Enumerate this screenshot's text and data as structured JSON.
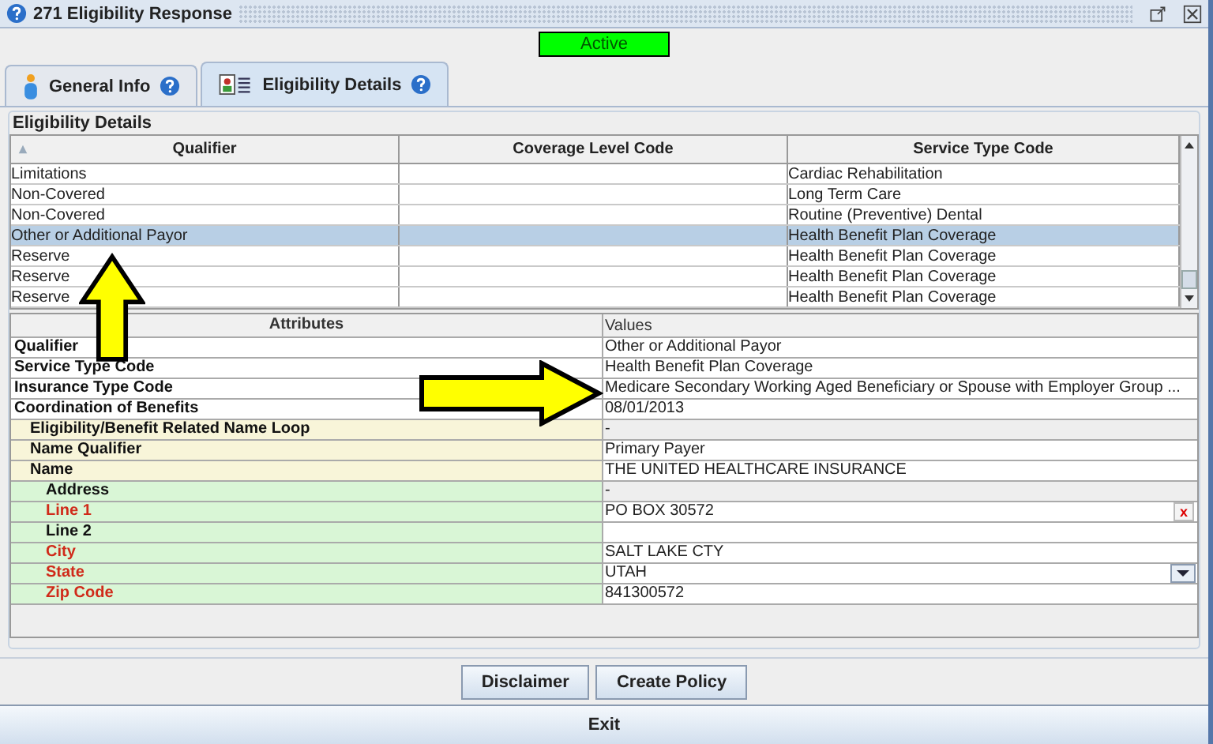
{
  "window": {
    "title": "271 Eligibility Response"
  },
  "status": {
    "label": "Active",
    "active": true
  },
  "tabs": [
    {
      "label": "General Info",
      "kind": "person",
      "selected": false
    },
    {
      "label": "Eligibility Details",
      "kind": "card",
      "selected": true
    }
  ],
  "group_title": "Eligibility Details",
  "table": {
    "columns": [
      "Qualifier",
      "Coverage Level Code",
      "Service Type Code"
    ],
    "rows": [
      {
        "cells": [
          "Limitations",
          "",
          "Cardiac Rehabilitation"
        ],
        "selected": false
      },
      {
        "cells": [
          "Non-Covered",
          "",
          "Long Term Care"
        ],
        "selected": false
      },
      {
        "cells": [
          "Non-Covered",
          "",
          "Routine (Preventive) Dental"
        ],
        "selected": false
      },
      {
        "cells": [
          "Other or Additional Payor",
          "",
          "Health Benefit Plan Coverage"
        ],
        "selected": true
      },
      {
        "cells": [
          "Reserve",
          "",
          "Health Benefit Plan Coverage"
        ],
        "selected": false
      },
      {
        "cells": [
          "Reserve",
          "",
          "Health Benefit Plan Coverage"
        ],
        "selected": false
      },
      {
        "cells": [
          "Reserve",
          "",
          "Health Benefit Plan Coverage"
        ],
        "selected": false
      }
    ]
  },
  "attributes": {
    "columns": [
      "Attributes",
      "Values"
    ],
    "rows": [
      {
        "name": "Qualifier",
        "value": "Other or Additional Payor",
        "kind": "text",
        "required": false
      },
      {
        "name": "Service Type Code",
        "value": "Health Benefit Plan Coverage",
        "kind": "text",
        "required": false
      },
      {
        "name": "Insurance Type Code",
        "value": "Medicare Secondary Working Aged Beneficiary or Spouse with Employer Group ...",
        "kind": "text",
        "required": false
      },
      {
        "name": "Coordination of Benefits",
        "value": "08/01/2013",
        "kind": "text",
        "required": false,
        "children": [
          {
            "name": "Eligibility/Benefit Related Name Loop",
            "value": "-",
            "kind": "group",
            "required": false
          },
          {
            "name": "Name Qualifier",
            "value": "Primary Payer",
            "kind": "text",
            "required": false
          },
          {
            "name": "Name",
            "value": "THE UNITED HEALTHCARE INSURANCE",
            "kind": "text",
            "required": false,
            "children": [
              {
                "name": "Address",
                "value": "-",
                "kind": "group",
                "required": false
              },
              {
                "name": "Line 1",
                "value": "PO BOX 30572",
                "kind": "clearable",
                "required": true
              },
              {
                "name": "Line 2",
                "kind": "text",
                "required": false
              },
              {
                "name": "City",
                "value": "SALT LAKE CTY",
                "kind": "text",
                "required": true
              },
              {
                "name": "State",
                "value": "UTAH",
                "kind": "dropdown",
                "required": true
              },
              {
                "name": "Zip Code",
                "value": "841300572",
                "kind": "text",
                "required": true
              }
            ]
          }
        ]
      }
    ]
  },
  "clear_mark": "x",
  "buttons": [
    "Disclaimer",
    "Create Policy"
  ],
  "exit_button": "Exit"
}
